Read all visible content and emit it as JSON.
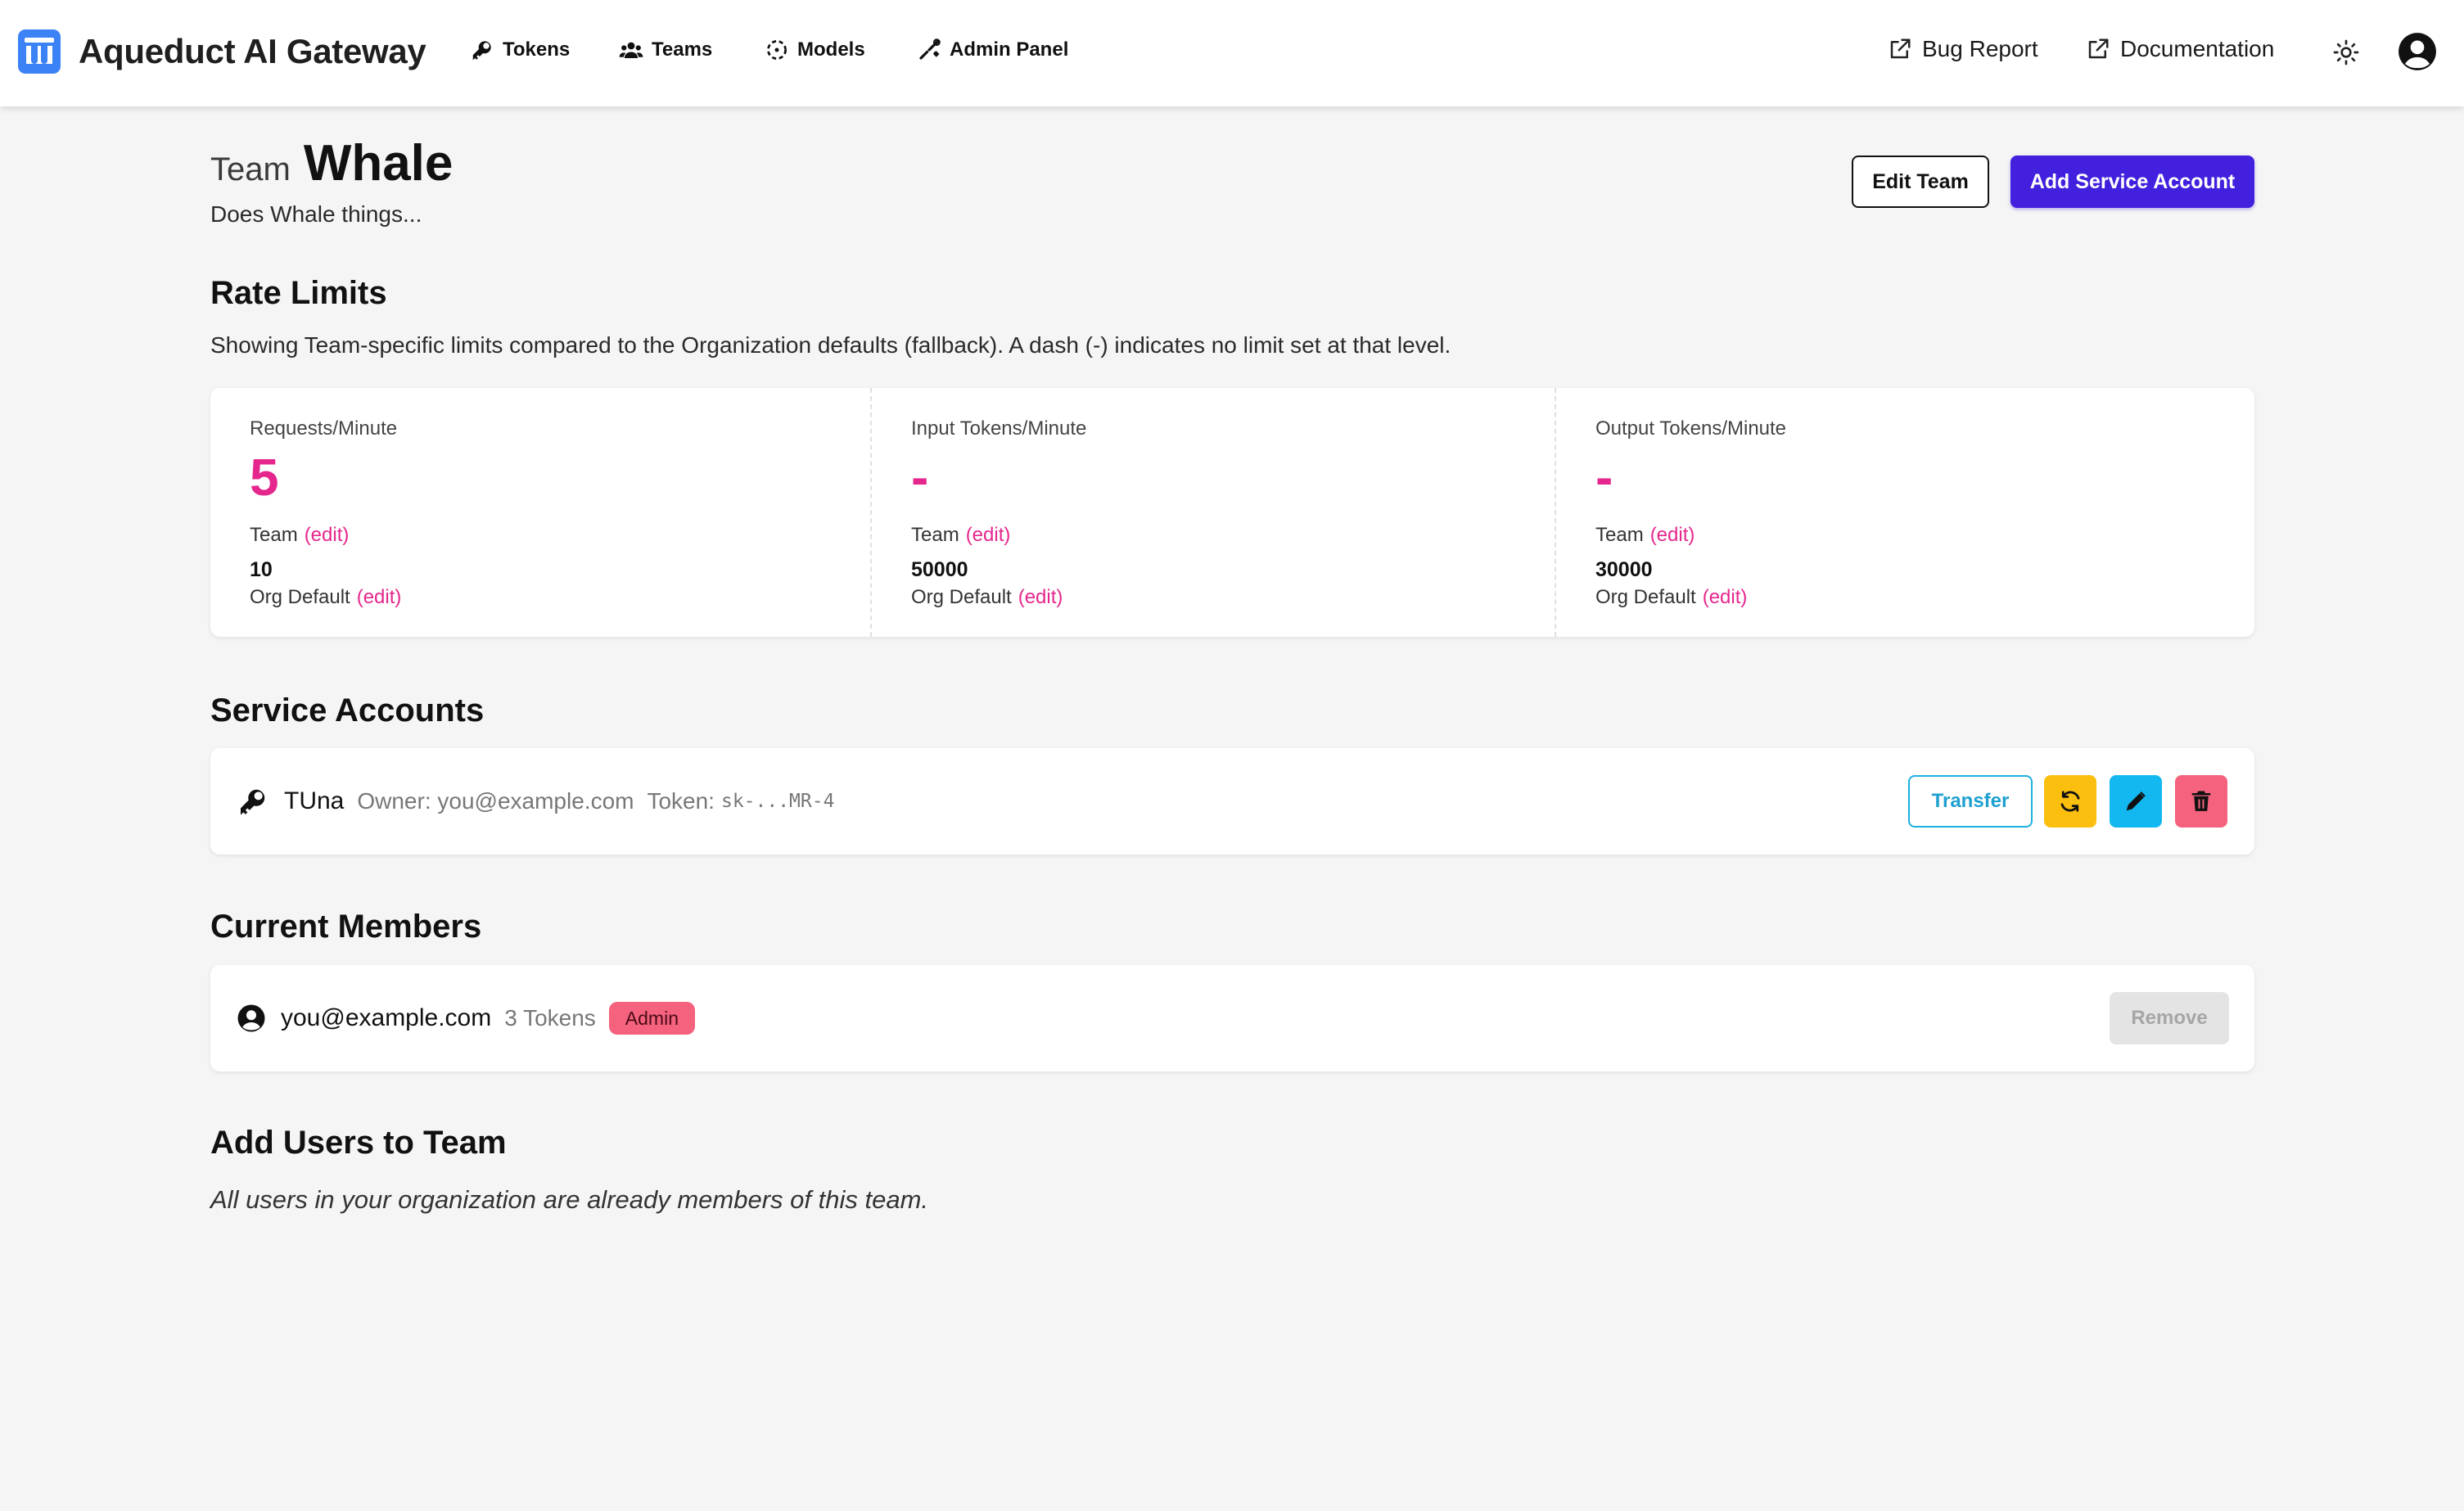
{
  "brand": {
    "name": "Aqueduct AI Gateway",
    "logo_icon": "aqueduct-logo-icon",
    "accent": "#3b82f6"
  },
  "nav": {
    "items": [
      {
        "label": "Tokens",
        "icon": "key-icon"
      },
      {
        "label": "Teams",
        "icon": "users-icon"
      },
      {
        "label": "Models",
        "icon": "models-icon"
      },
      {
        "label": "Admin Panel",
        "icon": "tools-icon"
      }
    ],
    "right": [
      {
        "label": "Bug Report",
        "icon": "external-link-icon"
      },
      {
        "label": "Documentation",
        "icon": "external-link-icon"
      }
    ],
    "theme_icon": "sun-icon",
    "account_icon": "user-circle-icon"
  },
  "team": {
    "prefix": "Team",
    "name": "Whale",
    "description": "Does Whale things...",
    "edit_button": "Edit Team",
    "add_service_account_button": "Add Service Account"
  },
  "rate_limits": {
    "title": "Rate Limits",
    "subtitle": "Showing Team-specific limits compared to the Organization defaults (fallback). A dash (-) indicates no limit set at that level.",
    "edit_link": "(edit)",
    "team_label": "Team",
    "org_label": "Org Default",
    "columns": [
      {
        "label": "Requests/Minute",
        "value": "5",
        "org_value": "10"
      },
      {
        "label": "Input Tokens/Minute",
        "value": "-",
        "org_value": "50000"
      },
      {
        "label": "Output Tokens/Minute",
        "value": "-",
        "org_value": "30000"
      }
    ],
    "accent": "#e5278d"
  },
  "service_accounts": {
    "title": "Service Accounts",
    "items": [
      {
        "name": "TUna",
        "owner_label": "Owner: you@example.com",
        "token_label": "Token:",
        "token": "sk-...MR-4",
        "transfer_label": "Transfer"
      }
    ],
    "button_colors": {
      "rotate": "#fbbf0f",
      "edit": "#14b8f0",
      "delete": "#f4627d"
    }
  },
  "members": {
    "title": "Current Members",
    "items": [
      {
        "email": "you@example.com",
        "tokens": "3 Tokens",
        "role": "Admin",
        "remove_label": "Remove"
      }
    ]
  },
  "add_users": {
    "title": "Add Users to Team",
    "note": "All users in your organization are already members of this team."
  }
}
